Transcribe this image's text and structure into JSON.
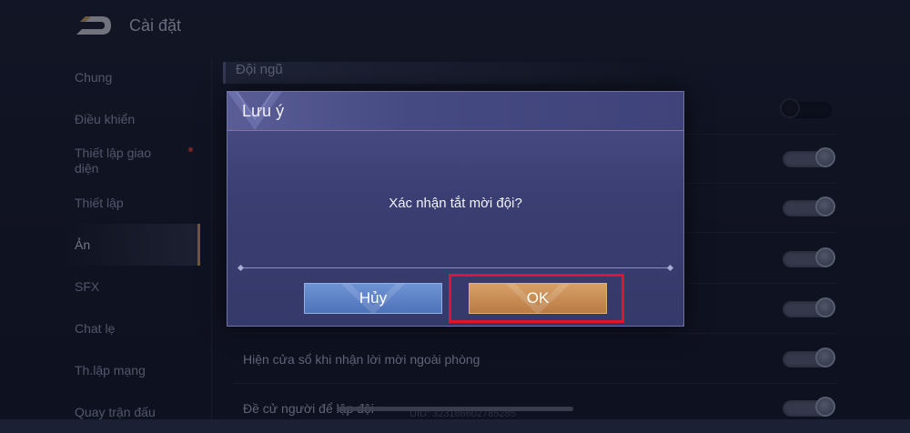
{
  "header": {
    "title": "Cài đặt",
    "back_icon": "back-arrow-icon"
  },
  "sidebar": {
    "items": [
      {
        "label": "Chung",
        "active": false
      },
      {
        "label": "Điều khiển",
        "active": false
      },
      {
        "label": "Thiết lập giao diện",
        "active": false,
        "notification": true
      },
      {
        "label": "Thiết lập",
        "active": false
      },
      {
        "label": "Ản",
        "active": true
      },
      {
        "label": "SFX",
        "active": false
      },
      {
        "label": "Chat lẹ",
        "active": false
      },
      {
        "label": "Th.lập mạng",
        "active": false
      },
      {
        "label": "Quay trận đấu",
        "active": false
      }
    ]
  },
  "content": {
    "section_title": "Đội ngũ",
    "rows": [
      {
        "label": "",
        "toggle_on": false
      },
      {
        "label": "",
        "toggle_on": true
      },
      {
        "label": "",
        "toggle_on": true
      },
      {
        "label": "",
        "toggle_on": true
      },
      {
        "label": "",
        "toggle_on": true
      },
      {
        "label": "Hiện cửa sổ khi nhận lời mời ngoài phòng",
        "toggle_on": true
      },
      {
        "label": "Đề cử người để lập đội",
        "toggle_on": true
      }
    ],
    "uid": "UID: 323186602785285"
  },
  "dialog": {
    "title": "Lưu ý",
    "message": "Xác nhận tắt mời đội?",
    "cancel_label": "Hủy",
    "ok_label": "OK"
  },
  "colors": {
    "background": "#1b2035",
    "dialog": "#3a3e72",
    "cancel_button": "#5a7fc4",
    "ok_button": "#c68c53",
    "highlight": "#e0142c",
    "toggle_on": "#5a6079",
    "toggle_off": "#111425"
  }
}
